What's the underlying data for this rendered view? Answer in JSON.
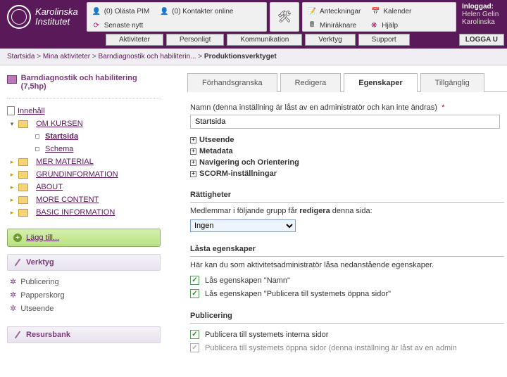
{
  "logo_text1": "Karolinska",
  "logo_text2": "Institutet",
  "header": {
    "pim": "(0) Olästa PIM",
    "contacts": "(0) Kontakter online",
    "news": "Senaste nytt",
    "notes": "Anteckningar",
    "calendar": "Kalender",
    "calc": "Miniräknare",
    "help": "Hjälp"
  },
  "login": {
    "label": "Inloggad:",
    "name": "Helen Gelin",
    "org": "Karolinska"
  },
  "nav": {
    "akt": "Aktiviteter",
    "pers": "Personligt",
    "komm": "Kommunikation",
    "verk": "Verktyg",
    "supp": "Support",
    "logout": "LOGGA U"
  },
  "bc": {
    "start": "Startsida",
    "mina": "Mina aktiviteter",
    "barn": "Barndiagnostik och habiliterin...",
    "prod": "Produktionsverktyget"
  },
  "course": "Barndiagnostik och habilitering (7,5hp)",
  "tree": {
    "innehall": "Innehåll",
    "om": "OM KURSEN",
    "start": "Startsida",
    "schema": "Schema",
    "mer": "MER MATERIAL",
    "grund": "GRUNDINFORMATION",
    "about": "ABOUT",
    "more": "MORE CONTENT",
    "basic": "BASIC INFORMATION"
  },
  "add": "Lägg till...",
  "verktyg_h": "Verktyg",
  "pub": "Publicering",
  "trash": "Papperskorg",
  "uts": "Utseende",
  "resurs": "Resursbank",
  "tabs": {
    "prev": "Förhandsgranska",
    "edit": "Redigera",
    "props": "Egenskaper",
    "avail": "Tillgänglig"
  },
  "form": {
    "name_label": "Namn (denna inställning är låst av en administratör och kan inte ändras)",
    "name_value": "Startsida",
    "utseende": "Utseende",
    "meta": "Metadata",
    "nav": "Navigering och Orientering",
    "scorm": "SCORM-inställningar",
    "rights_h": "Rättigheter",
    "rights_p1": "Medlemmar i följande grupp får ",
    "rights_b": "redigera",
    "rights_p2": " denna sida:",
    "sel": "Ingen",
    "locked_h": "Låsta egenskaper",
    "locked_p": "Här kan du som aktivitetsadministratör låsa nedanstående egenskaper.",
    "lock1": "Lås egenskapen \"Namn\"",
    "lock2": "Lås egenskapen \"Publicera till systemets öppna sidor\"",
    "pub_h": "Publicering",
    "pub1": "Publicera till systemets interna sidor",
    "pub2": "Publicera till systemets öppna sidor (denna inställning är låst av en admin"
  }
}
